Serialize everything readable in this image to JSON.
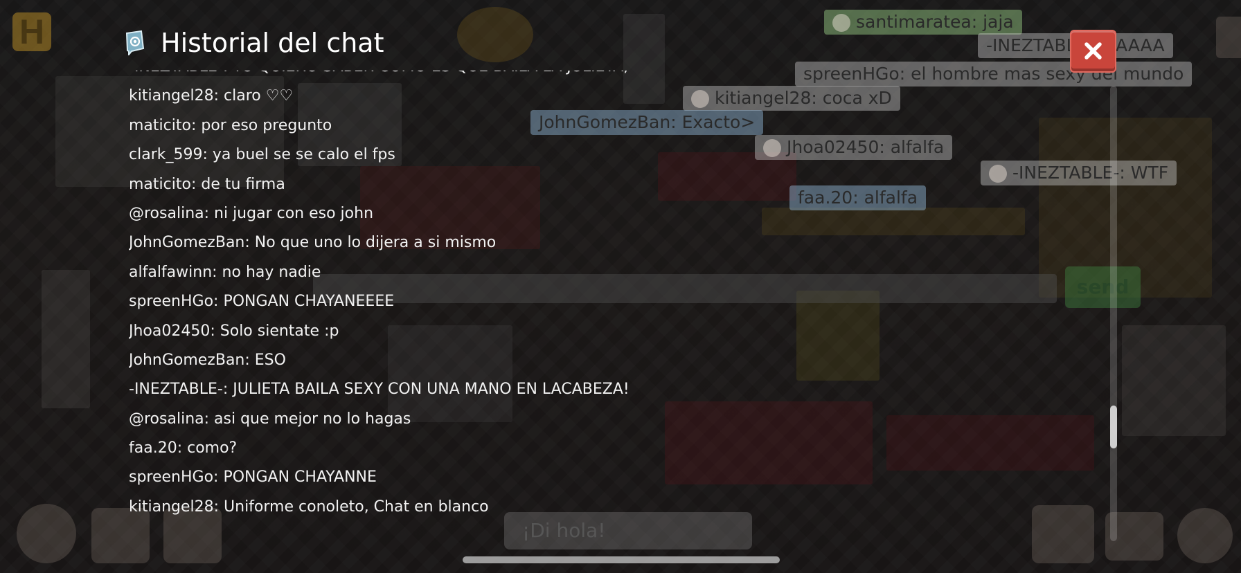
{
  "window": {
    "title": "Historial del chat",
    "close_icon": "close-icon"
  },
  "history": [
    "-INEZTABLE-: YO QUIERO SABER COMO ES QUE BAILA LA JULIETA;",
    "kitiangel28: claro ♡♡",
    "maticito: por eso pregunto",
    "clark_599: ya buel se se calo el fps",
    "maticito: de tu firma",
    "@rosalina: ni jugar con eso john",
    "JohnGomezBan: No que uno lo dijera a si mismo",
    "alfalfawinn: no hay nadie",
    "spreenHGo: PONGAN CHAYANEEEE",
    "Jhoa02450: Solo sientate :p",
    "JohnGomezBan: ESO",
    "-INEZTABLE-: JULIETA BAILA SEXY CON UNA MANO EN LACABEZA!",
    "@rosalina: asi que mejor no lo hagas",
    "faa.20: como?",
    "spreenHGo: PONGAN CHAYANNE",
    "kitiangel28: Uniforme conoleto, Chat en blanco"
  ],
  "bubbles": [
    "santimaratea: jaja",
    "-INEZTABLE-: SAAAA",
    "spreenHGo: el hombre mas sexy del mundo",
    "kitiangel28: coca xD",
    "JohnGomezBan: Exacto>",
    "Jhoa02450: alfalfa",
    "-INEZTABLE-: WTF",
    "faa.20: alfalfa"
  ],
  "hud": {
    "logo_letter": "H",
    "send_label": "send",
    "say_placeholder": "¡Di hola!"
  },
  "colors": {
    "close_button": "#c9453b",
    "text": "#f2f2f2"
  }
}
